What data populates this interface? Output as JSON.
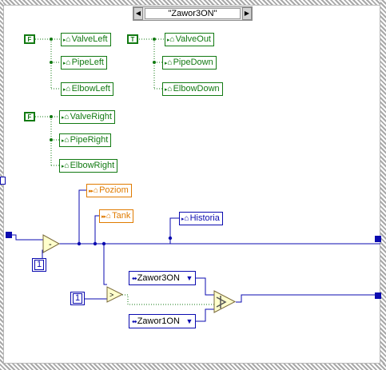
{
  "case_selector": {
    "value": "\"Zawor3ON\"",
    "decrement_arrow": "◀",
    "increment_arrow": "▶"
  },
  "group1": {
    "constant": "F",
    "locals": [
      "ValveLeft",
      "PipeLeft",
      "ElbowLeft"
    ]
  },
  "group2": {
    "constant": "T",
    "locals": [
      "ValveOut",
      "PipeDown",
      "ElbowDown"
    ]
  },
  "group3": {
    "constant": "F",
    "locals": [
      "ValveRight",
      "PipeRight",
      "ElbowRight"
    ]
  },
  "orange_locals": [
    "Poziom",
    "Tank"
  ],
  "historia": "Historia",
  "constants": {
    "one_top": "1",
    "one_bottom": "1"
  },
  "rings": [
    "Zawor3ON",
    "Zawor1ON"
  ],
  "colors": {
    "boolean": "#127a12",
    "numeric": "#e07b00",
    "integer": "#0b0bb0"
  }
}
